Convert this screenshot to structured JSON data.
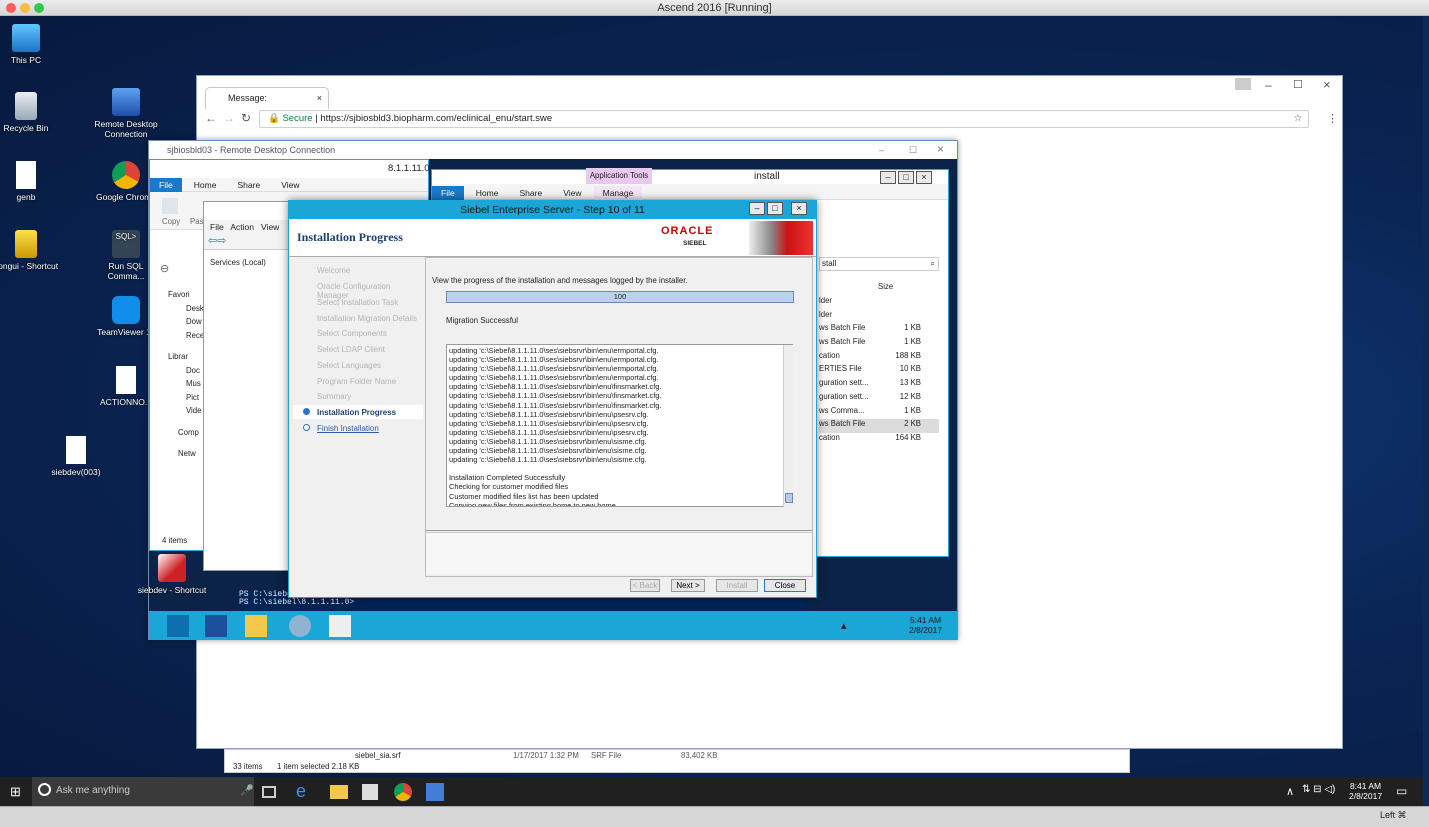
{
  "host": {
    "window_title": "Ascend 2016 [Running]"
  },
  "desktop": {
    "icons": [
      {
        "label": "This PC",
        "name": "this-pc-icon"
      },
      {
        "label": "Recycle Bin",
        "name": "recycle-bin-icon"
      },
      {
        "label": "genb",
        "name": "file-icon"
      },
      {
        "label": "vpngui - Shortcut",
        "name": "vpn-shortcut-icon"
      },
      {
        "label": "Remote Desktop Connection",
        "name": "remote-desktop-icon"
      },
      {
        "label": "Google Chrome",
        "name": "chrome-icon"
      },
      {
        "label": "Run SQL Comma...",
        "name": "sql-icon"
      },
      {
        "label": "TeamViewer 11",
        "name": "teamviewer-icon"
      },
      {
        "label": "ACTIONNO...",
        "name": "file-icon"
      },
      {
        "label": "siebdev(003)",
        "name": "file-icon"
      }
    ]
  },
  "chrome": {
    "tab_title": "Message:",
    "secure_label": "Secure",
    "url": "https://sjbiosbld3.biopharm.com/eclinical_enu/start.swe"
  },
  "rdc": {
    "title": "sjbiosbld03 - Remote Desktop Connection",
    "explorer": {
      "version_fragment": "8.1.1.11.0",
      "tabs": [
        "File",
        "Home",
        "Share",
        "View"
      ],
      "tools": [
        "Copy",
        "Pas"
      ],
      "nav": [
        "Favori",
        "Desk",
        "Dow",
        "Rece",
        "Librar",
        "Doc",
        "Mus",
        "Pict",
        "Vide",
        "Comp",
        "Netw"
      ],
      "status": "4 items"
    },
    "services": {
      "menu": [
        "File",
        "Action",
        "View"
      ],
      "tree_item": "Services (Local)"
    },
    "install": {
      "title": "install",
      "context_tab": "Application Tools",
      "tabs": [
        "File",
        "Home",
        "Share",
        "View",
        "Manage"
      ],
      "search": "stall",
      "size_header": "Size",
      "rows": [
        {
          "type": "lder",
          "size": ""
        },
        {
          "type": "lder",
          "size": ""
        },
        {
          "type": "ws Batch File",
          "size": "1 KB"
        },
        {
          "type": "ws Batch File",
          "size": "1 KB"
        },
        {
          "type": "cation",
          "size": "188 KB"
        },
        {
          "type": "ERTIES File",
          "size": "10 KB"
        },
        {
          "type": "guration sett...",
          "size": "13 KB"
        },
        {
          "type": "guration sett...",
          "size": "12 KB"
        },
        {
          "type": "ws Comma...",
          "size": "1 KB"
        },
        {
          "type": "ws Batch File",
          "size": "2 KB"
        },
        {
          "type": "cation",
          "size": "164 KB"
        }
      ]
    },
    "powershell": [
      "PS C:\\siebel",
      "PS C:\\siebel\\8.1.1.11.0>"
    ],
    "siebdev_shortcut": "siebdev - Shortcut",
    "clock": {
      "time": "5:41 AM",
      "date": "2/8/2017"
    }
  },
  "siebel": {
    "title": "Siebel Enterprise Server - Step 10 of 11",
    "heading": "Installation Progress",
    "brand_top": "ORACLE",
    "brand_bottom": "SIEBEL",
    "steps": [
      "Welcome",
      "Oracle Configuration Manager",
      "Select Installation Task",
      "Installation Migration Details",
      "Select Components",
      "Select LDAP Client",
      "Select Languages",
      "Program Folder Name",
      "Summary",
      "Installation Progress",
      "Finish Installation"
    ],
    "instruction": "View the progress of the installation and messages logged by the installer.",
    "progress": {
      "value": 100,
      "label": "100"
    },
    "status": "Migration Successful",
    "log": [
      "updating 'c:\\Siebel\\8.1.1.11.0\\ses\\siebsrvr\\bin\\enu\\ermportal.cfg.",
      "updating 'c:\\Siebel\\8.1.1.11.0\\ses\\siebsrvr\\bin\\enu\\ermportal.cfg.",
      "updating 'c:\\Siebel\\8.1.1.11.0\\ses\\siebsrvr\\bin\\enu\\ermportal.cfg.",
      "updating 'c:\\Siebel\\8.1.1.11.0\\ses\\siebsrvr\\bin\\enu\\ermportal.cfg.",
      "updating 'c:\\Siebel\\8.1.1.11.0\\ses\\siebsrvr\\bin\\enu\\finsmarket.cfg.",
      "updating 'c:\\Siebel\\8.1.1.11.0\\ses\\siebsrvr\\bin\\enu\\finsmarket.cfg.",
      "updating 'c:\\Siebel\\8.1.1.11.0\\ses\\siebsrvr\\bin\\enu\\finsmarket.cfg.",
      "updating 'c:\\Siebel\\8.1.1.11.0\\ses\\siebsrvr\\bin\\enu\\psesrv.cfg.",
      "updating 'c:\\Siebel\\8.1.1.11.0\\ses\\siebsrvr\\bin\\enu\\psesrv.cfg.",
      "updating 'c:\\Siebel\\8.1.1.11.0\\ses\\siebsrvr\\bin\\enu\\psesrv.cfg.",
      "updating 'c:\\Siebel\\8.1.1.11.0\\ses\\siebsrvr\\bin\\enu\\sisme.cfg.",
      "updating 'c:\\Siebel\\8.1.1.11.0\\ses\\siebsrvr\\bin\\enu\\sisme.cfg.",
      "updating 'c:\\Siebel\\8.1.1.11.0\\ses\\siebsrvr\\bin\\enu\\sisme.cfg.",
      "",
      "Installation Completed Successfully",
      "Checking for customer modified files",
      "Customer modified files list has been updated",
      "Copying new files from existing home to new home",
      "Migration Successful"
    ],
    "buttons": {
      "back": "< Back",
      "next": "Next >",
      "install": "Install",
      "close": "Close"
    }
  },
  "outer_explorer": {
    "items_count": "33 items",
    "selection": "1 item selected  2.18 KB",
    "file_name": "siebel_sia.srf",
    "file_date": "1/17/2017 1:32 PM",
    "file_type": "SRF File",
    "file_size": "83,402 KB"
  },
  "taskbar": {
    "search_placeholder": "Ask me anything",
    "time": "8:41 AM",
    "date": "2/8/2017"
  },
  "mac_strip": {
    "host_key": "Left ⌘"
  }
}
